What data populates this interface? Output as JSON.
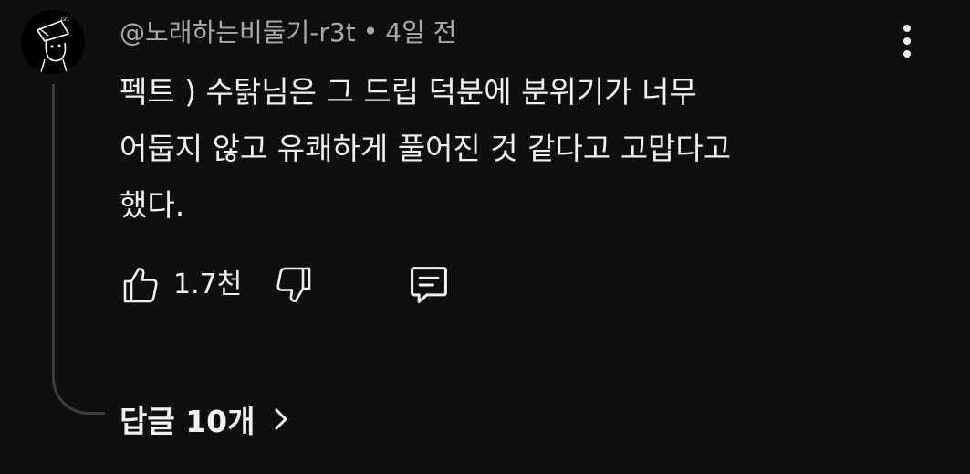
{
  "comment": {
    "author": "@노래하는비둘기-r3t",
    "separator": "•",
    "time": "4일 전",
    "text_lines": [
      "펙트 ) 수탉님은 그 드립 덕분에 분위기가 너무",
      "어둡지 않고 유쾌하게 풀어진 것 같다고 고맙다고",
      "했다."
    ],
    "like_count": "1.7천",
    "replies_label": "답글 10개"
  },
  "icons": {
    "avatar": "avatar-drawing",
    "menu": "more-vertical-icon",
    "like": "thumb-up-icon",
    "dislike": "thumb-down-icon",
    "reply": "comment-icon",
    "chevron": "chevron-right-icon"
  },
  "colors": {
    "background": "#0f0f0f",
    "text": "#f1f1f1",
    "meta_text": "#aaaaaa",
    "thread_line": "#3d3d3d"
  }
}
